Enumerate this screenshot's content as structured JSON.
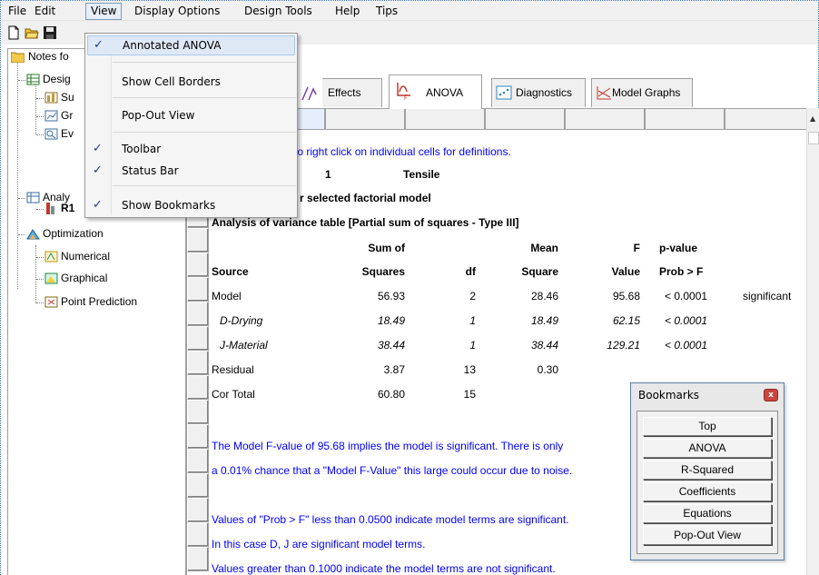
{
  "menubar": {
    "items": [
      "File",
      "Edit",
      "View",
      "Display Options",
      "Design Tools",
      "Help",
      "Tips"
    ]
  },
  "view_menu": {
    "items": [
      {
        "label": "Annotated ANOVA",
        "checked": true
      },
      {
        "label": "Show Cell Borders",
        "checked": false
      },
      {
        "label": "Pop-Out View",
        "checked": false
      },
      {
        "label": "Toolbar",
        "checked": true
      },
      {
        "label": "Status Bar",
        "checked": true
      },
      {
        "label": "Show Bookmarks",
        "checked": true
      }
    ]
  },
  "tree": {
    "notes": "Notes fo",
    "design": "Desig",
    "su": "Su",
    "gr": "Gr",
    "ev": "Ev",
    "analysis": "Analy",
    "r1": "R1",
    "optimization": "Optimization",
    "numerical": "Numerical",
    "graphical": "Graphical",
    "point_prediction": "Point Prediction"
  },
  "tabs": {
    "effects": "Effects",
    "anova": "ANOVA",
    "diagnostics": "Diagnostics",
    "model_graphs": "Model Graphs"
  },
  "anova": {
    "hint": "e to right click on individual cells for definitions.",
    "response_num": "1",
    "response_name": "Tensile",
    "model_title": "r selected factorial model",
    "table_title": "Analysis of variance table [Partial sum of squares - Type III]",
    "headers_top": {
      "sum_of": "Sum of",
      "mean": "Mean",
      "f": "F",
      "pvalue": "p-value"
    },
    "headers_bottom": {
      "source": "Source",
      "squares": "Squares",
      "df": "df",
      "square": "Square",
      "value": "Value",
      "prob": "Prob > F"
    },
    "rows": [
      {
        "source": "Model",
        "ss": "56.93",
        "df": "2",
        "ms": "28.46",
        "f": "95.68",
        "p": "< 0.0001",
        "note": "significant"
      },
      {
        "source": "D-Drying",
        "ss": "18.49",
        "df": "1",
        "ms": "18.49",
        "f": "62.15",
        "p": "< 0.0001",
        "note": ""
      },
      {
        "source": "J-Material",
        "ss": "38.44",
        "df": "1",
        "ms": "38.44",
        "f": "129.21",
        "p": "< 0.0001",
        "note": ""
      },
      {
        "source": "Residual",
        "ss": "3.87",
        "df": "13",
        "ms": "0.30",
        "f": "",
        "p": "",
        "note": ""
      },
      {
        "source": "Cor Total",
        "ss": "60.80",
        "df": "15",
        "ms": "",
        "f": "",
        "p": "",
        "note": ""
      }
    ],
    "notes": [
      "The Model F-value of 95.68 implies the model is significant.  There is only",
      "a 0.01% chance that a \"Model F-Value\" this large could occur due to noise.",
      "Values of \"Prob > F\" less than 0.0500 indicate model terms are significant.",
      "In this case D, J are significant model terms.",
      "Values greater than 0.1000 indicate the model terms are not significant."
    ]
  },
  "bookmarks": {
    "title": "Bookmarks",
    "close": "x",
    "buttons": [
      "Top",
      "ANOVA",
      "R-Squared",
      "Coefficients",
      "Equations",
      "Pop-Out View"
    ]
  },
  "colors": {
    "link_blue": "#0000ff",
    "menu_highlight": "#dfe9f6",
    "close_red": "#c9463d"
  }
}
